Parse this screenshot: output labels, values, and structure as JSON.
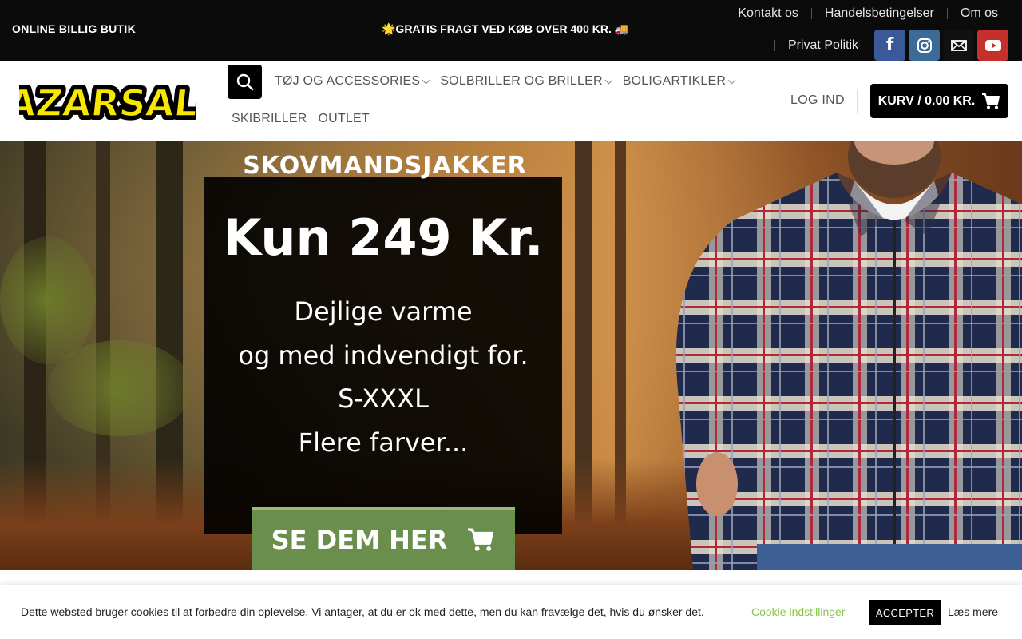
{
  "topbar": {
    "shop_name": "ONLINE BILLIG BUTIK",
    "promo": "🌟GRATIS FRAGT VED KØB OVER 400 KR. 🚚",
    "links": [
      "Kontakt os",
      "Handelsbetingelser",
      "Om os"
    ],
    "privacy": "Privat Politik",
    "social_icons": [
      "facebook-icon",
      "instagram-icon",
      "email-icon",
      "youtube-icon"
    ]
  },
  "header": {
    "logo_text": "BAZARSALG",
    "nav_row1": [
      "TØJ OG ACCESSORIES",
      "SOLBRILLER OG BRILLER",
      "BOLIGARTIKLER"
    ],
    "nav_row2": [
      "SKIBRILLER",
      "OUTLET"
    ],
    "login": "LOG IND",
    "cart": "KURV / 0.00 KR."
  },
  "hero": {
    "title": "SKOVMANDSJAKKER",
    "price": "Kun 249 Kr.",
    "lines": [
      "Dejlige varme",
      "og med indvendigt for.",
      "S-XXXL",
      "Flere farver..."
    ],
    "cta": "SE DEM HER"
  },
  "cookie": {
    "message": "Dette websted bruger cookies til at forbedre din oplevelse. Vi antager, at du er ok med dette, men du kan fravælge det, hvis du ønsker det.",
    "settings": "Cookie indstillinger",
    "accept": "ACCEPTER",
    "read_more": "Læs mere"
  },
  "colors": {
    "topbar_bg": "#0b0b0b",
    "logo_yellow": "#f7e600",
    "cta_green": "#6a8e4c",
    "cookie_link": "#8bc34a",
    "facebook": "#3a5998",
    "instagram": "#3b6b96",
    "youtube": "#c4302b"
  }
}
